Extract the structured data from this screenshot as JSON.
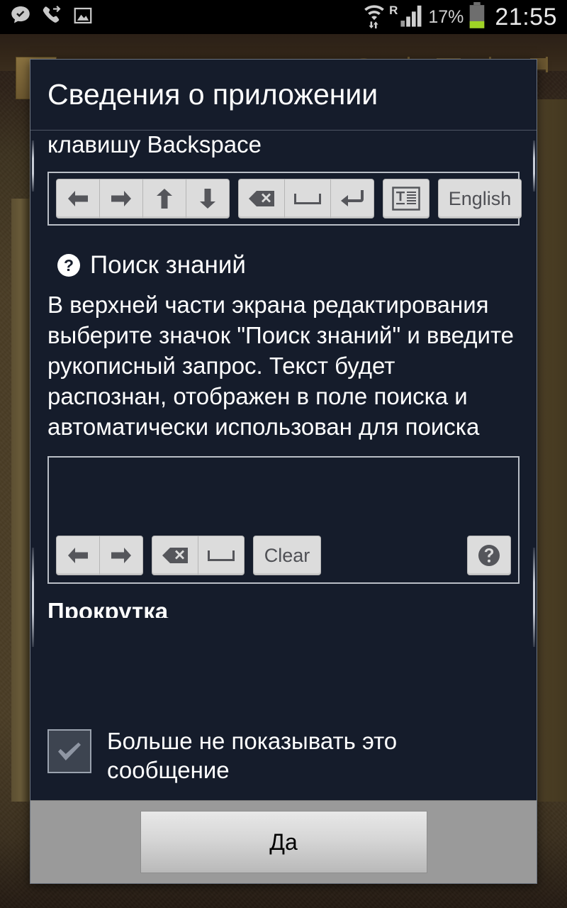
{
  "status_bar": {
    "icons": [
      {
        "name": "message-check-icon",
        "glyph": "message-check"
      },
      {
        "name": "call-forward-icon",
        "glyph": "phone-arrow"
      },
      {
        "name": "picture-icon",
        "glyph": "image"
      }
    ],
    "wifi_label": "wifi-transfer-icon",
    "roaming": "R",
    "signal_label": "signal-bars-icon",
    "battery_percent": "17%",
    "battery_label": "battery-icon",
    "clock": "21:55"
  },
  "dialog": {
    "title": "Сведения о приложении",
    "clipped_top_line": "клавишу Backspace",
    "toolbar_top": {
      "group_nav": [
        {
          "name": "arrow-left-icon",
          "glyph": "arrow-left",
          "label": ""
        },
        {
          "name": "arrow-right-icon",
          "glyph": "arrow-right",
          "label": ""
        },
        {
          "name": "arrow-up-icon",
          "glyph": "arrow-up",
          "label": ""
        },
        {
          "name": "arrow-down-icon",
          "glyph": "arrow-down",
          "label": ""
        }
      ],
      "group_edit": [
        {
          "name": "backspace-icon",
          "glyph": "backspace",
          "label": ""
        },
        {
          "name": "space-icon",
          "glyph": "space",
          "label": ""
        },
        {
          "name": "enter-icon",
          "glyph": "enter",
          "label": ""
        }
      ],
      "group_extra": [
        {
          "name": "text-document-icon",
          "glyph": "text-doc",
          "label": ""
        }
      ],
      "language_button": "English"
    },
    "section": {
      "heading": "Поиск знаний",
      "help_glyph": "?",
      "body": "В верхней части экрана редактирования выберите значок \"Поиск знаний\" и введите рукописный запрос. Текст будет распознан, отображен в поле поиска и автоматически использован для поиска"
    },
    "toolbar_bottom": {
      "group_nav": [
        {
          "name": "arrow-left-icon",
          "glyph": "arrow-left",
          "label": ""
        },
        {
          "name": "arrow-right-icon",
          "glyph": "arrow-right",
          "label": ""
        }
      ],
      "group_edit": [
        {
          "name": "backspace-icon",
          "glyph": "backspace",
          "label": ""
        },
        {
          "name": "space-icon",
          "glyph": "space",
          "label": ""
        }
      ],
      "clear_button": "Clear",
      "help_button": "?"
    },
    "next_section_clipped": "Прокрутка",
    "checkbox": {
      "label": "Больше не показывать это сообщение",
      "checked": true
    },
    "confirm_button": "Да"
  },
  "colors": {
    "dialog_bg": "#151c2b",
    "dialog_border": "#6c7480",
    "footer_bg": "#9a9a9a",
    "key_bg": "#dcdcdc",
    "key_fg": "#4f5055",
    "battery_fill": "#9fd325",
    "text": "#ffffff"
  }
}
